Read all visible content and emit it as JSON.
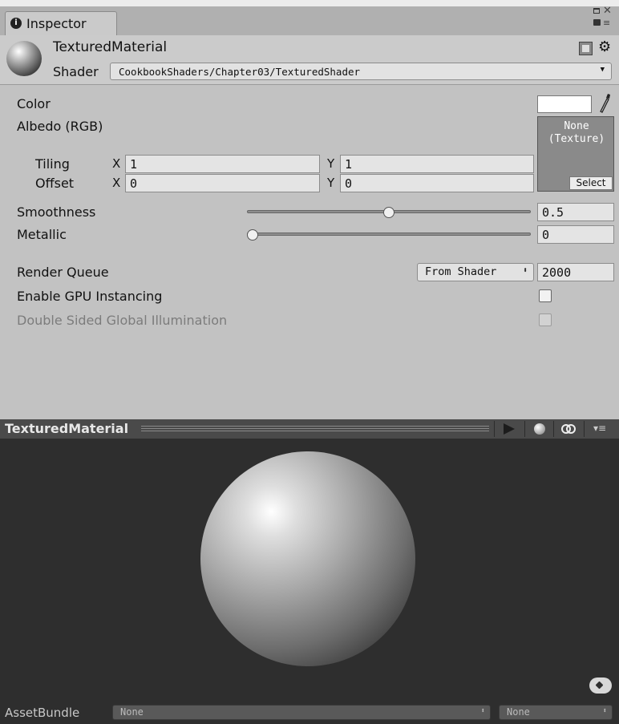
{
  "tab": {
    "title": "Inspector"
  },
  "header": {
    "material_name": "TexturedMaterial",
    "shader_label": "Shader",
    "shader_value": "CookbookShaders/Chapter03/TexturedShader"
  },
  "properties": {
    "color_label": "Color",
    "albedo_label": "Albedo (RGB)",
    "texture_slot": {
      "line1": "None",
      "line2": "(Texture)",
      "select_label": "Select"
    },
    "tiling": {
      "label": "Tiling",
      "x_label": "X",
      "x": "1",
      "y_label": "Y",
      "y": "1"
    },
    "offset": {
      "label": "Offset",
      "x_label": "X",
      "x": "0",
      "y_label": "Y",
      "y": "0"
    },
    "smoothness": {
      "label": "Smoothness",
      "value": "0.5",
      "fraction": 0.5
    },
    "metallic": {
      "label": "Metallic",
      "value": "0",
      "fraction": 0.0
    },
    "render_queue": {
      "label": "Render Queue",
      "mode": "From Shader",
      "value": "2000"
    },
    "gpu_instancing": {
      "label": "Enable GPU Instancing",
      "checked": false
    },
    "double_sided_gi": {
      "label": "Double Sided Global Illumination",
      "checked": false,
      "enabled": false
    }
  },
  "preview": {
    "title": "TexturedMaterial",
    "icons": [
      "play-icon",
      "sphere-icon",
      "light-icon",
      "menu-icon"
    ]
  },
  "asset_bundle": {
    "label": "AssetBundle",
    "name": "None",
    "variant": "None"
  },
  "colors": {
    "albedo_color": "#ffffff",
    "preview_bg": "#2e2e2e",
    "panel_bg": "#c2c2c2"
  }
}
